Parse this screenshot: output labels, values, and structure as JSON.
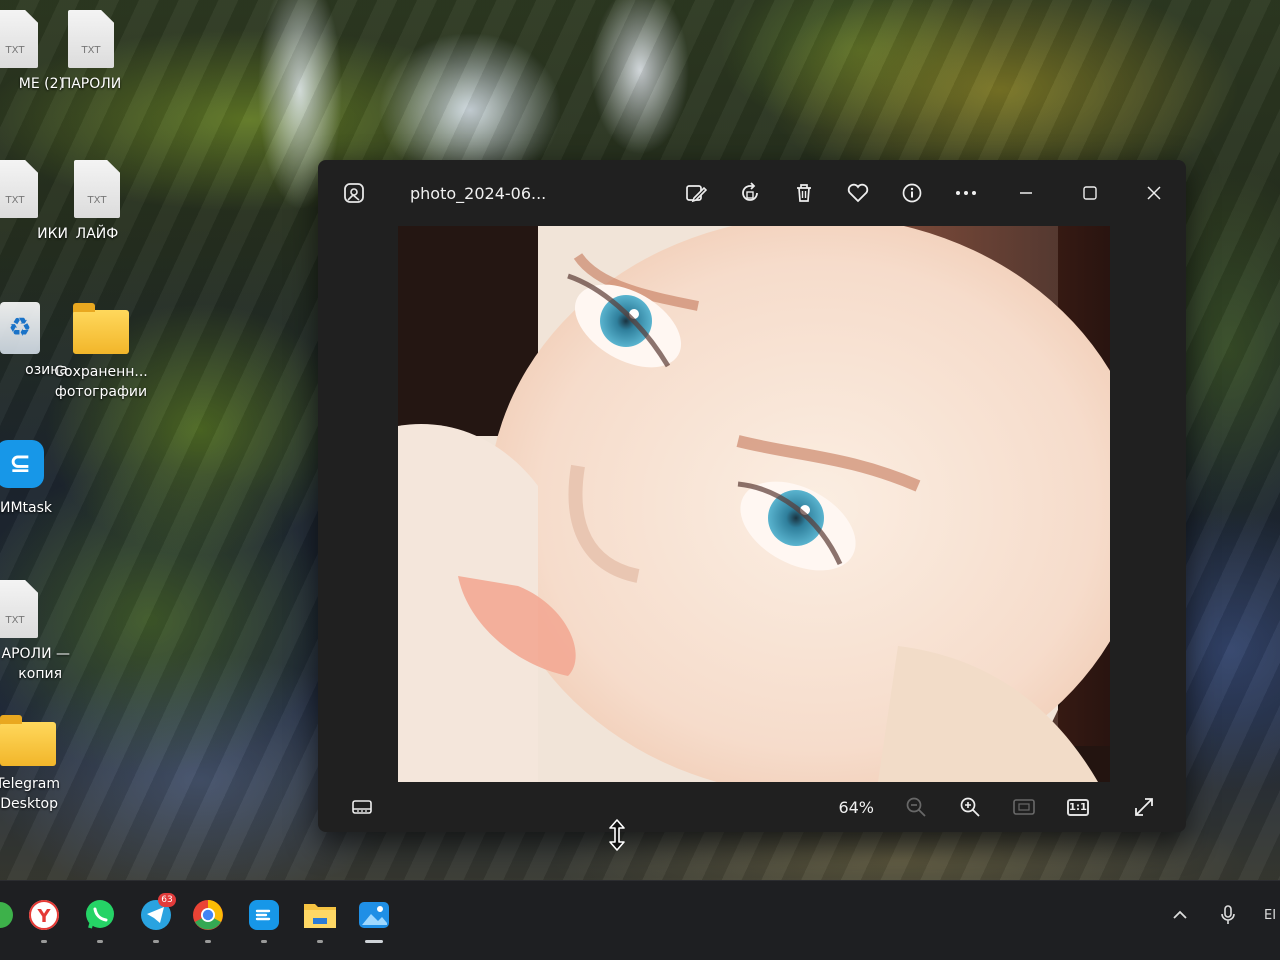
{
  "desktop": {
    "icons": [
      {
        "label": "МЕ (2)",
        "kind": "txt"
      },
      {
        "label": "ПАРОЛИ",
        "kind": "txt"
      },
      {
        "label": "ИКИ",
        "kind": "txt"
      },
      {
        "label": "ЛАЙФ",
        "kind": "txt"
      },
      {
        "label": "озина",
        "kind": "recycle"
      },
      {
        "label_line1": "Сохраненн...",
        "label_line2": "фотографии",
        "kind": "folder"
      },
      {
        "label": "ИMtask",
        "kind": "app"
      },
      {
        "label_line1": "АРОЛИ —",
        "label_line2": "копия",
        "kind": "txt"
      },
      {
        "label_line1": "Telegram",
        "label_line2": "Desktop",
        "kind": "folder"
      }
    ],
    "txt_badge": "TXT"
  },
  "photos_window": {
    "title": "photo_2024-06...",
    "toolbar": {
      "edit_icon": "edit-image-icon",
      "rotate_icon": "rotate-icon",
      "delete_icon": "trash-icon",
      "favorite_icon": "heart-icon",
      "info_icon": "info-icon",
      "more_icon": "more-icon"
    },
    "controls": {
      "minimize": "minimize-icon",
      "maximize": "maximize-icon",
      "close": "close-icon"
    },
    "statusbar": {
      "filmstrip_icon": "filmstrip-icon",
      "zoom": "64%",
      "zoom_out_icon": "zoom-out-icon",
      "zoom_in_icon": "zoom-in-icon",
      "fit_icon": "fit-to-window-icon",
      "actual_size_label": "1:1",
      "fullscreen_icon": "fullscreen-icon"
    }
  },
  "taskbar": {
    "apps": [
      {
        "name": "yandex-browser",
        "icon": "Y"
      },
      {
        "name": "whatsapp"
      },
      {
        "name": "telegram",
        "badge": "63"
      },
      {
        "name": "chrome"
      },
      {
        "name": "mmtask"
      },
      {
        "name": "file-explorer"
      },
      {
        "name": "photos",
        "active": true
      }
    ],
    "tray": {
      "lang": "EI"
    }
  },
  "colors": {
    "window_bg": "#202020",
    "taskbar_bg": "#1e1f22",
    "accent_blue": "#1797e8",
    "badge_red": "#e23b3b"
  }
}
